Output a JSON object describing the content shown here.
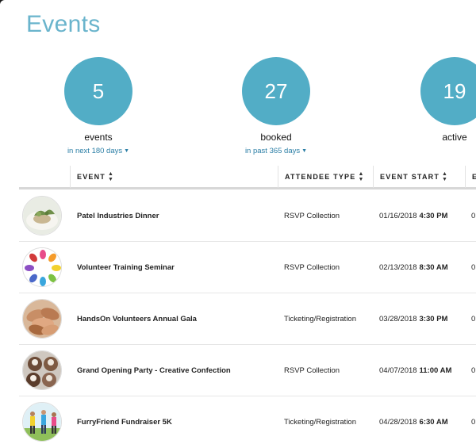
{
  "page": {
    "title": "Events"
  },
  "stats": [
    {
      "value": "5",
      "label": "events",
      "sub": "in next 180 days"
    },
    {
      "value": "27",
      "label": "booked",
      "sub": "in past 365 days"
    },
    {
      "value": "19",
      "label": "active"
    }
  ],
  "columns": {
    "event": "EVENT",
    "attendee_type": "ATTENDEE TYPE",
    "event_start": "EVENT START",
    "extra": "E"
  },
  "rows": [
    {
      "name": "Patel Industries Dinner",
      "attendee_type": "RSVP Collection",
      "date": "01/16/2018",
      "time": "4:30 PM",
      "extra": "0"
    },
    {
      "name": "Volunteer Training Seminar",
      "attendee_type": "RSVP Collection",
      "date": "02/13/2018",
      "time": "8:30 AM",
      "extra": "0"
    },
    {
      "name": "HandsOn Volunteers Annual Gala",
      "attendee_type": "Ticketing/Registration",
      "date": "03/28/2018",
      "time": "3:30 PM",
      "extra": "0"
    },
    {
      "name": "Grand Opening Party - Creative Confection",
      "attendee_type": "RSVP Collection",
      "date": "04/07/2018",
      "time": "11:00 AM",
      "extra": "0"
    },
    {
      "name": "FurryFriend Fundraiser 5K",
      "attendee_type": "Ticketing/Registration",
      "date": "04/28/2018",
      "time": "6:30 AM",
      "extra": "0"
    }
  ],
  "colors": {
    "accent": "#52adc6",
    "title": "#6ab4cc",
    "link": "#2c7fa6"
  }
}
